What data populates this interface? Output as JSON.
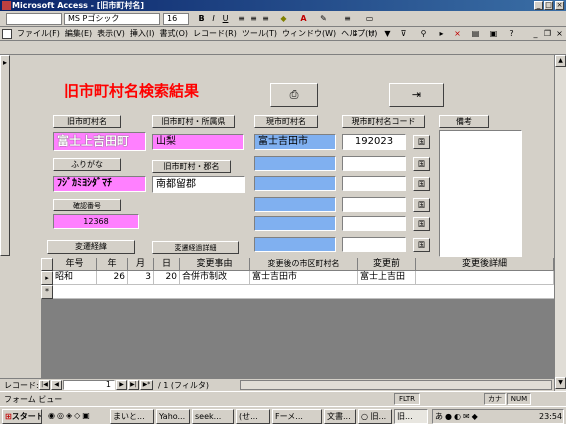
{
  "window": {
    "title": "Microsoft Access - [旧市町村名]"
  },
  "fmt_toolbar": {
    "font_name": "MS Pゴシック",
    "font_size": "16"
  },
  "menu": [
    "ファイル(F)",
    "編集(E)",
    "表示(V)",
    "挿入(I)",
    "書式(O)",
    "レコード(R)",
    "ツール(T)",
    "ウィンドウ(W)",
    "ヘルプ(H)"
  ],
  "form": {
    "title": "旧市町村名検索結果",
    "labels": {
      "old_name": "旧市町村名",
      "old_pref": "旧市町村・所属県",
      "cur_name": "現市町村名",
      "cur_code": "現市町村名コード",
      "remarks": "備考",
      "furigana": "ふりがな",
      "old_gun": "旧市町村・郡名",
      "confirm_no": "確認番号"
    },
    "values": {
      "old_name": "富士上吉田町",
      "old_pref": "山梨",
      "cur_name": "富士吉田市",
      "cur_code": "192023",
      "furigana": "ﾌｼﾞｶﾐﾖｼﾀﾞﾏﾁ",
      "old_gun": "南都留郡",
      "confirm_no": "12368"
    },
    "buttons": {
      "history": "変遷経緯",
      "history_detail": "変遷経過詳細",
      "small": "国"
    }
  },
  "grid": {
    "columns": [
      "年号",
      "年",
      "月",
      "日",
      "変更事由",
      "変更後の市区町村名",
      "変更前",
      "変更後詳細"
    ],
    "rows": [
      [
        "昭和",
        "26",
        "3",
        "20",
        "合併市制改",
        "富士吉田市",
        "富士上吉田",
        ""
      ]
    ]
  },
  "nav": {
    "label": "レコード:",
    "current": "1",
    "total": "/ 1 (フィルタ)"
  },
  "status": {
    "left": "フォーム ビュー",
    "fltr": "FLTR",
    "kana": "カナ",
    "num": "NUM"
  },
  "taskbar": {
    "start": "スタート",
    "tasks": [
      "まいと...",
      "Yaho...",
      "seek...",
      "(せ...",
      "Fーメ...",
      "文書...",
      "○ 旧...",
      "旧..."
    ],
    "clock": "23:54"
  },
  "colors": {
    "pink": "#ff80ff",
    "blue": "#80b0f0",
    "title_red": "#ff0000"
  }
}
